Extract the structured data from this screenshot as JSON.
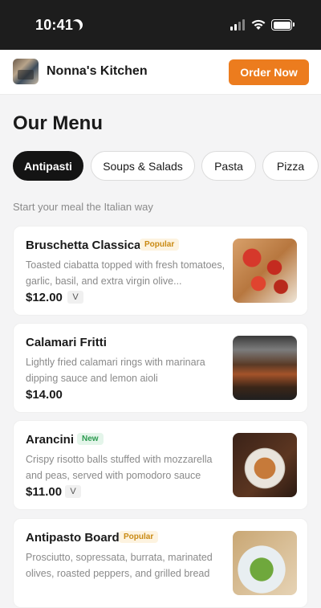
{
  "status_bar": {
    "time": "10:41"
  },
  "header": {
    "brand": "Nonna's Kitchen",
    "order_button": "Order Now"
  },
  "page": {
    "title": "Our Menu",
    "subtitle": "Start your meal the Italian way"
  },
  "tabs": [
    {
      "label": "Antipasti",
      "active": true
    },
    {
      "label": "Soups & Salads",
      "active": false
    },
    {
      "label": "Pasta",
      "active": false
    },
    {
      "label": "Pizza",
      "active": false
    }
  ],
  "menu_items": [
    {
      "name": "Bruschetta Classica",
      "badge": "Popular",
      "description": "Toasted ciabatta topped with fresh tomatoes, garlic, basil, and extra virgin olive...",
      "price": "$12.00",
      "diet": "V",
      "image": "bruschetta"
    },
    {
      "name": "Calamari Fritti",
      "badge": "",
      "description": "Lightly fried calamari rings with marinara dipping sauce and lemon aioli",
      "price": "$14.00",
      "diet": "",
      "image": "calamari"
    },
    {
      "name": "Arancini",
      "badge": "New",
      "description": "Crispy risotto balls stuffed with mozzarella and peas, served with pomodoro sauce",
      "price": "$11.00",
      "diet": "V",
      "image": "arancini"
    },
    {
      "name": "Antipasto Board",
      "badge": "Popular",
      "description": "Prosciutto, sopressata, burrata, marinated olives, roasted peppers, and grilled bread",
      "price": "",
      "diet": "",
      "image": "antipasto"
    }
  ],
  "icons": [
    "moon-icon",
    "signal-icon",
    "wifi-icon",
    "battery-icon"
  ],
  "colors": {
    "accent": "#ec7c1e",
    "active_tab": "#141414",
    "popular_badge": "#c98a14",
    "new_badge": "#2b9a4f"
  }
}
